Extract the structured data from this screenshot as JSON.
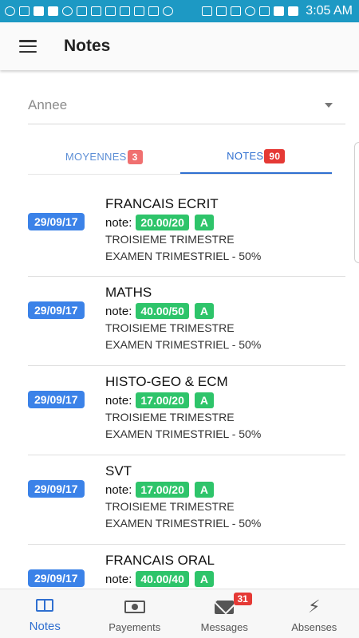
{
  "status_bar": {
    "time": "3:05 AM",
    "battery": "85%"
  },
  "app_bar": {
    "title": "Notes"
  },
  "year_select": {
    "placeholder": "Annee"
  },
  "tabs": [
    {
      "label": "MOYENNES",
      "badge": "3",
      "active": false
    },
    {
      "label": "NOTES",
      "badge": "90",
      "active": true
    }
  ],
  "notes": [
    {
      "date": "29/09/17",
      "subject": "FRANCAIS ECRIT",
      "note_prefix": "note:",
      "grade": "20.00/20",
      "letter": "A",
      "period": "TROISIEME TRIMESTRE",
      "exam": "EXAMEN TRIMESTRIEL - 50%"
    },
    {
      "date": "29/09/17",
      "subject": "MATHS",
      "note_prefix": "note:",
      "grade": "40.00/50",
      "letter": "A",
      "period": "TROISIEME TRIMESTRE",
      "exam": "EXAMEN TRIMESTRIEL - 50%"
    },
    {
      "date": "29/09/17",
      "subject": "HISTO-GEO & ECM",
      "note_prefix": "note:",
      "grade": "17.00/20",
      "letter": "A",
      "period": "TROISIEME TRIMESTRE",
      "exam": "EXAMEN TRIMESTRIEL - 50%"
    },
    {
      "date": "29/09/17",
      "subject": "SVT",
      "note_prefix": "note:",
      "grade": "17.00/20",
      "letter": "A",
      "period": "TROISIEME TRIMESTRE",
      "exam": "EXAMEN TRIMESTRIEL - 50%"
    },
    {
      "date": "29/09/17",
      "subject": "FRANCAIS ORAL",
      "note_prefix": "note:",
      "grade": "40.00/40",
      "letter": "A",
      "period": "",
      "exam": ""
    }
  ],
  "bottom_nav": [
    {
      "label": "Notes",
      "icon": "book-icon",
      "active": true,
      "badge": ""
    },
    {
      "label": "Payements",
      "icon": "cash-icon",
      "active": false,
      "badge": ""
    },
    {
      "label": "Messages",
      "icon": "mail-icon",
      "active": false,
      "badge": "31"
    },
    {
      "label": "Absenses",
      "icon": "bolt-icon",
      "active": false,
      "badge": ""
    }
  ],
  "colors": {
    "status_bar": "#1d99c4",
    "accent": "#2f6fd0",
    "date_badge": "#3b82e8",
    "grade_badge": "#2ec46a",
    "count_badge": "#e53935"
  }
}
